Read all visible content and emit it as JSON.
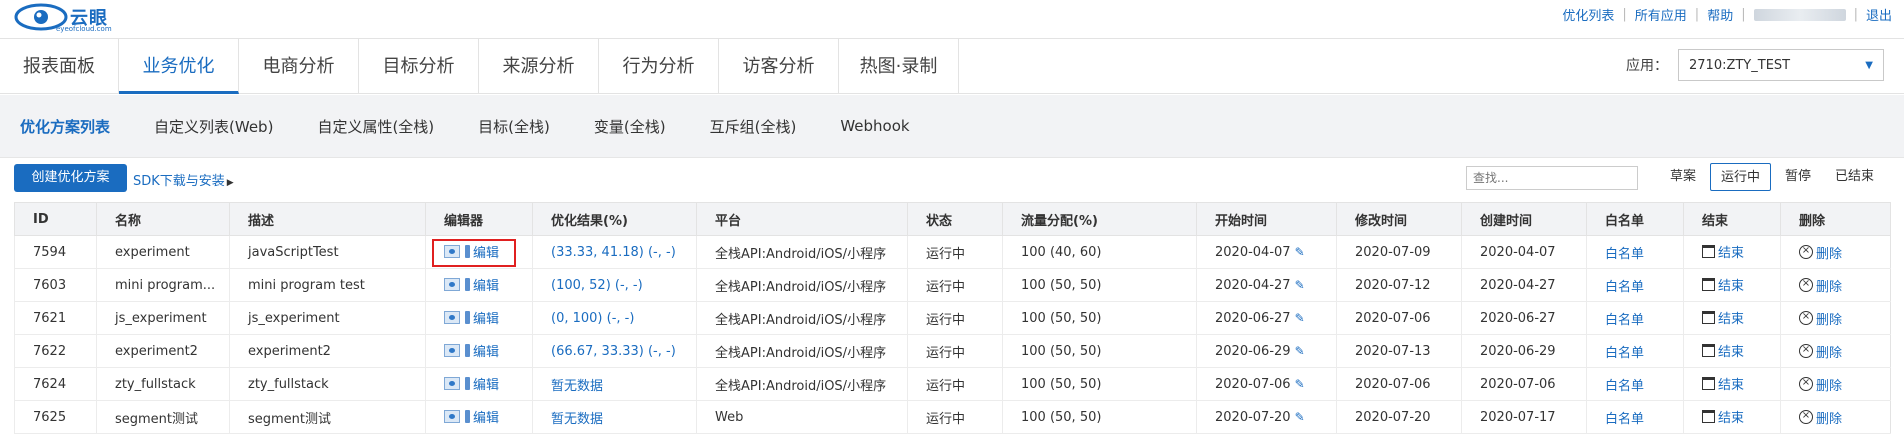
{
  "header": {
    "logo_text": "云眼",
    "logo_url": "eyeofcloud.com",
    "links": [
      "优化列表",
      "所有应用",
      "帮助",
      "退出"
    ]
  },
  "main_nav": {
    "tabs": [
      "报表面板",
      "业务优化",
      "电商分析",
      "目标分析",
      "来源分析",
      "行为分析",
      "访客分析",
      "热图·录制"
    ],
    "active": "业务优化",
    "app_label": "应用：",
    "app_value": "2710:ZTY_TEST"
  },
  "sub_nav": {
    "items": [
      "优化方案列表",
      "自定义列表(Web)",
      "自定义属性(全栈)",
      "目标(全栈)",
      "变量(全栈)",
      "互斥组(全栈)",
      "Webhook"
    ],
    "active": "优化方案列表"
  },
  "toolbar": {
    "create_label": "创建优化方案",
    "sdk_label": "SDK下载与安装",
    "search_placeholder": "查找...",
    "filters": [
      "草案",
      "运行中",
      "暂停",
      "已结束"
    ],
    "active_filter": "运行中"
  },
  "table": {
    "headers": [
      "ID",
      "名称",
      "描述",
      "编辑器",
      "优化结果(%)",
      "平台",
      "状态",
      "流量分配(%)",
      "开始时间",
      "修改时间",
      "创建时间",
      "白名单",
      "结束",
      "删除"
    ],
    "edit_label": "编辑",
    "whitelist_label": "白名单",
    "end_label": "结束",
    "delete_label": "删除",
    "rows": [
      {
        "id": "7594",
        "name": "experiment",
        "desc": "javaScriptTest",
        "result": "(33.33, 41.18) (-, -)",
        "platform": "全栈API:Android/iOS/小程序",
        "status": "运行中",
        "traffic": "100 (40, 60)",
        "start": "2020-04-07",
        "modified": "2020-07-09",
        "created": "2020-04-07"
      },
      {
        "id": "7603",
        "name": "mini program...",
        "desc": "mini program test",
        "result": "(100, 52) (-, -)",
        "platform": "全栈API:Android/iOS/小程序",
        "status": "运行中",
        "traffic": "100 (50, 50)",
        "start": "2020-04-27",
        "modified": "2020-07-12",
        "created": "2020-04-27"
      },
      {
        "id": "7621",
        "name": "js_experiment",
        "desc": "js_experiment",
        "result": "(0, 100) (-, -)",
        "platform": "全栈API:Android/iOS/小程序",
        "status": "运行中",
        "traffic": "100 (50, 50)",
        "start": "2020-06-27",
        "modified": "2020-07-06",
        "created": "2020-06-27"
      },
      {
        "id": "7622",
        "name": "experiment2",
        "desc": "experiment2",
        "result": "(66.67, 33.33) (-, -)",
        "platform": "全栈API:Android/iOS/小程序",
        "status": "运行中",
        "traffic": "100 (50, 50)",
        "start": "2020-06-29",
        "modified": "2020-07-13",
        "created": "2020-06-29"
      },
      {
        "id": "7624",
        "name": "zty_fullstack",
        "desc": "zty_fullstack",
        "result": "暂无数据",
        "platform": "全栈API:Android/iOS/小程序",
        "status": "运行中",
        "traffic": "100 (50, 50)",
        "start": "2020-07-06",
        "modified": "2020-07-06",
        "created": "2020-07-06"
      },
      {
        "id": "7625",
        "name": "segment测试",
        "desc": "segment测试",
        "result": "暂无数据",
        "platform": "Web",
        "status": "运行中",
        "traffic": "100 (50, 50)",
        "start": "2020-07-20",
        "modified": "2020-07-20",
        "created": "2020-07-17"
      }
    ]
  },
  "colors": {
    "accent": "#1a6cc0",
    "highlight": "#e02020"
  }
}
